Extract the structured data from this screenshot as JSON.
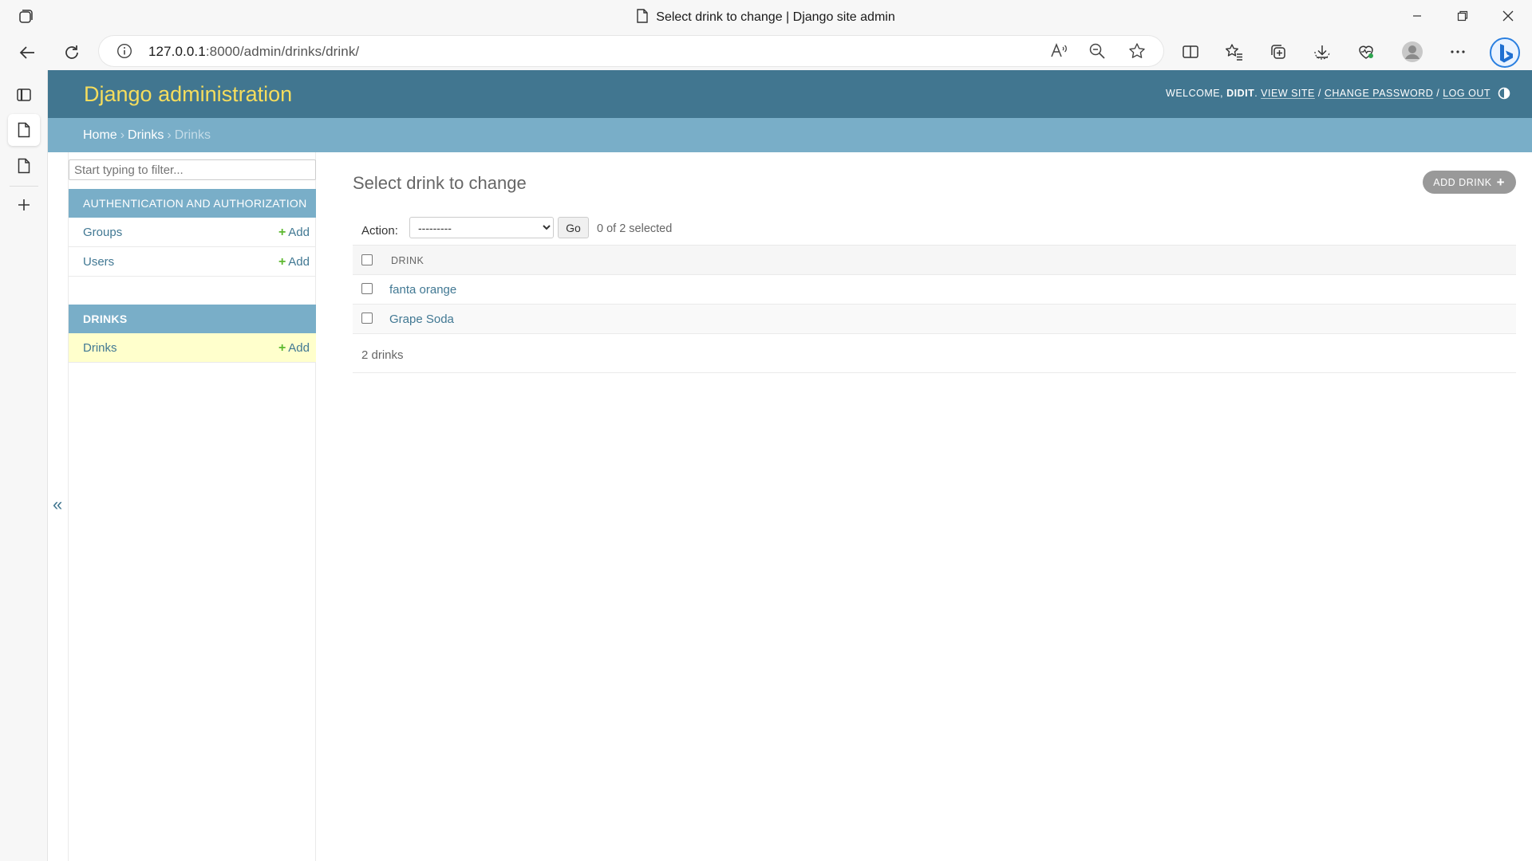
{
  "browser": {
    "tab_title": "Select drink to change | Django site admin",
    "url_host": "127.0.0.1",
    "url_rest": ":8000/admin/drinks/drink/",
    "read_aloud": "Á"
  },
  "header": {
    "brand": "Django administration",
    "welcome": "WELCOME,",
    "username": "DIDIT",
    "view_site": "VIEW SITE",
    "change_password": "CHANGE PASSWORD",
    "log_out": "LOG OUT",
    "slash": "/"
  },
  "breadcrumbs": {
    "home": "Home",
    "app": "Drinks",
    "current": "Drinks",
    "sep": "›"
  },
  "sidebar": {
    "filter_placeholder": "Start typing to filter...",
    "modules": [
      {
        "caption": "AUTHENTICATION AND AUTHORIZATION",
        "items": [
          {
            "name": "Groups",
            "add": "Add"
          },
          {
            "name": "Users",
            "add": "Add"
          }
        ]
      },
      {
        "caption": "DRINKS",
        "items": [
          {
            "name": "Drinks",
            "add": "Add"
          }
        ]
      }
    ],
    "collapse": "«"
  },
  "content": {
    "title": "Select drink to change",
    "add_button": "ADD DRINK",
    "action_label": "Action:",
    "action_selected": "---------",
    "go_label": "Go",
    "selected_count": "0 of 2 selected",
    "column_header": "DRINK",
    "rows": [
      "fanta orange",
      "Grape Soda"
    ],
    "paginator": "2 drinks"
  },
  "colors": {
    "header_bg": "#417690",
    "breadcrumbs_bg": "#79aec8",
    "brand_text": "#f5dd5d",
    "link": "#417893",
    "add_plus": "#5cb82e",
    "current_row": "#ffffcc"
  }
}
